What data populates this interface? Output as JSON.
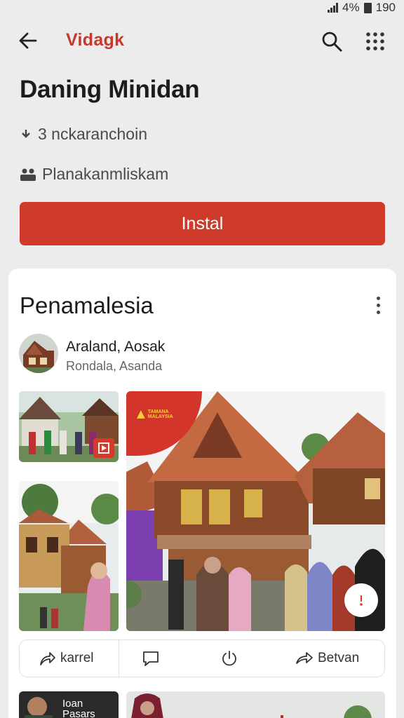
{
  "status": {
    "battery": "4%",
    "time": "190"
  },
  "header": {
    "app_name": "Vidagk"
  },
  "app": {
    "title": "Daning Minidan",
    "meta1": "3 nckaranchoin",
    "meta2": "Planakanmliskam",
    "install_label": "Instal"
  },
  "post": {
    "title": "Penamalesia",
    "author_name": "Araland, Aosak",
    "author_sub": "Rondala, Asanda",
    "promo_text": "TAMANA MALAYSIA",
    "actions": {
      "share_label": "karrel",
      "send_label": "Betvan"
    },
    "bottom_thumb_text": "Ioan Pasars"
  },
  "colors": {
    "accent": "#cf3b2b",
    "background": "#ececec",
    "card": "#ffffff"
  }
}
